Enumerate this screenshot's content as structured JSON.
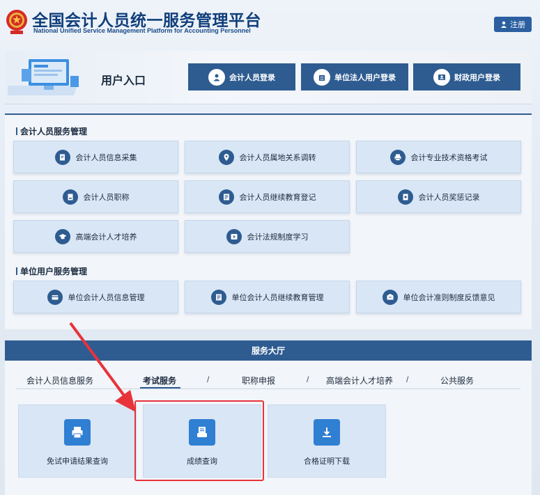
{
  "header": {
    "title_cn": "全国会计人员统一服务管理平台",
    "title_en": "National Unified Service Management Platform for Accounting Personnel",
    "register_label": "注册"
  },
  "entry": {
    "label": "用户入口",
    "buttons": [
      {
        "label": "会计人员登录",
        "icon": "person-icon"
      },
      {
        "label": "单位法人用户登录",
        "icon": "building-icon"
      },
      {
        "label": "财政用户登录",
        "icon": "id-card-icon"
      }
    ]
  },
  "accountant_services": {
    "title": "会计人员服务管理",
    "items": [
      {
        "label": "会计人员信息采集",
        "icon": "edit-doc-icon"
      },
      {
        "label": "会计人员属地关系调转",
        "icon": "location-icon"
      },
      {
        "label": "会计专业技术资格考试",
        "icon": "printer-icon"
      },
      {
        "label": "会计人员职称",
        "icon": "certificate-icon"
      },
      {
        "label": "会计人员继续教育登记",
        "icon": "form-icon"
      },
      {
        "label": "会计人员奖惩记录",
        "icon": "record-icon"
      },
      {
        "label": "高端会计人才培养",
        "icon": "graduation-cap-icon"
      },
      {
        "label": "会计法规制度学习",
        "icon": "play-icon"
      }
    ]
  },
  "unit_services": {
    "title": "单位用户服务管理",
    "items": [
      {
        "label": "单位会计人员信息管理",
        "icon": "card-icon"
      },
      {
        "label": "单位会计人员继续教育管理",
        "icon": "form-icon"
      },
      {
        "label": "单位会计准则制度反馈意见",
        "icon": "feedback-icon"
      }
    ]
  },
  "hall": {
    "title": "服务大厅",
    "tabs": [
      "会计人员信息服务",
      "考试服务",
      "职称申报",
      "高端会计人才培养",
      "公共服务"
    ],
    "active_tab": "考试服务",
    "separator": "/",
    "cards": [
      {
        "label": "免试申请结果查询",
        "icon": "printer-icon"
      },
      {
        "label": "成绩查询",
        "icon": "document-icon"
      },
      {
        "label": "合格证明下载",
        "icon": "download-icon"
      }
    ]
  },
  "colors": {
    "primary": "#2e5c91",
    "card_bg": "#d9e6f5",
    "highlight": "#e8333a",
    "tile_blue": "#2f7fd3"
  }
}
